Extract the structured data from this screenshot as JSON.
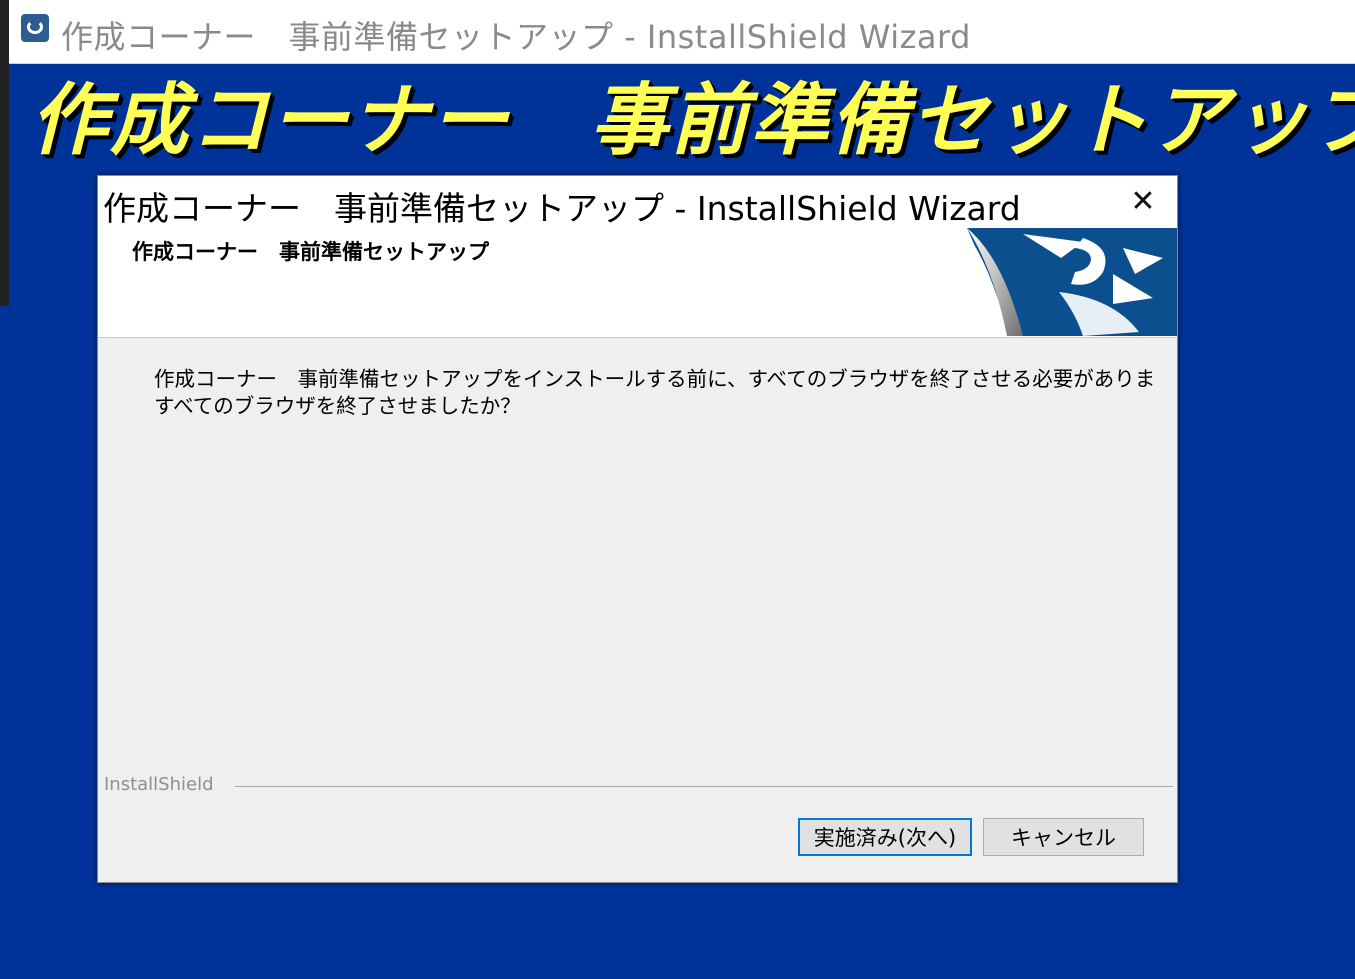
{
  "window": {
    "title": "作成コーナー　事前準備セットアップ - InstallShield Wizard"
  },
  "banner": {
    "text": "作成コーナー　事前準備セットアップ"
  },
  "dialog": {
    "title": "作成コーナー　事前準備セットアップ - InstallShield Wizard",
    "close_glyph": "✕",
    "subtitle": "作成コーナー　事前準備セットアップ",
    "message_line1": "作成コーナー　事前準備セットアップをインストールする前に、すべてのブラウザを終了させる必要がありま",
    "message_line2": "すべてのブラウザを終了させましたか？",
    "brand": "InstallShield",
    "buttons": {
      "next": "実施済み(次へ)",
      "cancel": "キャンセル"
    }
  },
  "colors": {
    "desktop_background": "#003399",
    "banner_text": "#ffff55",
    "focus_border": "#0078d7"
  }
}
